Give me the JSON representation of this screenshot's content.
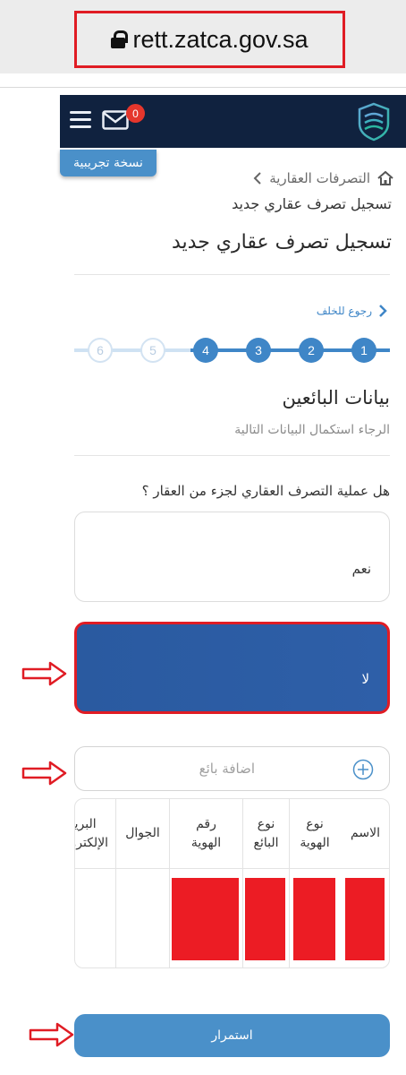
{
  "browser": {
    "url": "rett.zatca.gov.sa"
  },
  "header": {
    "notification_count": "0",
    "beta_label": "نسخة تجريبية"
  },
  "breadcrumb": {
    "item": "التصرفات العقارية",
    "current": "تسجيل تصرف عقاري جديد"
  },
  "page": {
    "title": "تسجيل تصرف عقاري جديد",
    "back_label": "رجوع للخلف"
  },
  "stepper": {
    "steps": [
      "1",
      "2",
      "3",
      "4",
      "5",
      "6"
    ],
    "current_step": 4,
    "total": 6
  },
  "section": {
    "title": "بيانات البائعين",
    "subtitle": "الرجاء استكمال البيانات التالية"
  },
  "question": {
    "text": "هل عملية التصرف العقاري لجزء من العقار ؟",
    "option_yes": "نعم",
    "option_no": "لا",
    "selected": "لا"
  },
  "sellers": {
    "add_label": "اضافة بائع",
    "columns": [
      "الاسم",
      "نوع الهوية",
      "نوع البائع",
      "رقم الهوية",
      "الجوال",
      "البريد الإلكتروني"
    ]
  },
  "actions": {
    "continue_label": "استمرار"
  },
  "colors": {
    "primary": "#3f86c7",
    "header_bg": "#10223f",
    "selected_option": "#2e5fa8",
    "highlight_red": "#e01c24"
  }
}
